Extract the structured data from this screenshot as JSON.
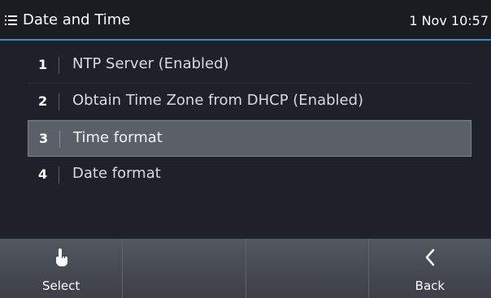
{
  "header": {
    "title": "Date and Time",
    "clock": "1 Nov 10:57",
    "menu_icon": "hamburger-menu-icon",
    "accent_color": "#2f8fd0"
  },
  "menu": {
    "items": [
      {
        "index": "1",
        "label": "NTP Server (Enabled)",
        "selected": false
      },
      {
        "index": "2",
        "label": "Obtain Time Zone from DHCP (Enabled)",
        "selected": false
      },
      {
        "index": "3",
        "label": "Time format",
        "selected": true
      },
      {
        "index": "4",
        "label": "Date format",
        "selected": false
      }
    ]
  },
  "softkeys": [
    {
      "label": "Select",
      "icon": "hand-pointer-icon"
    },
    {
      "label": "",
      "icon": ""
    },
    {
      "label": "",
      "icon": ""
    },
    {
      "label": "Back",
      "icon": "chevron-left-icon"
    }
  ]
}
